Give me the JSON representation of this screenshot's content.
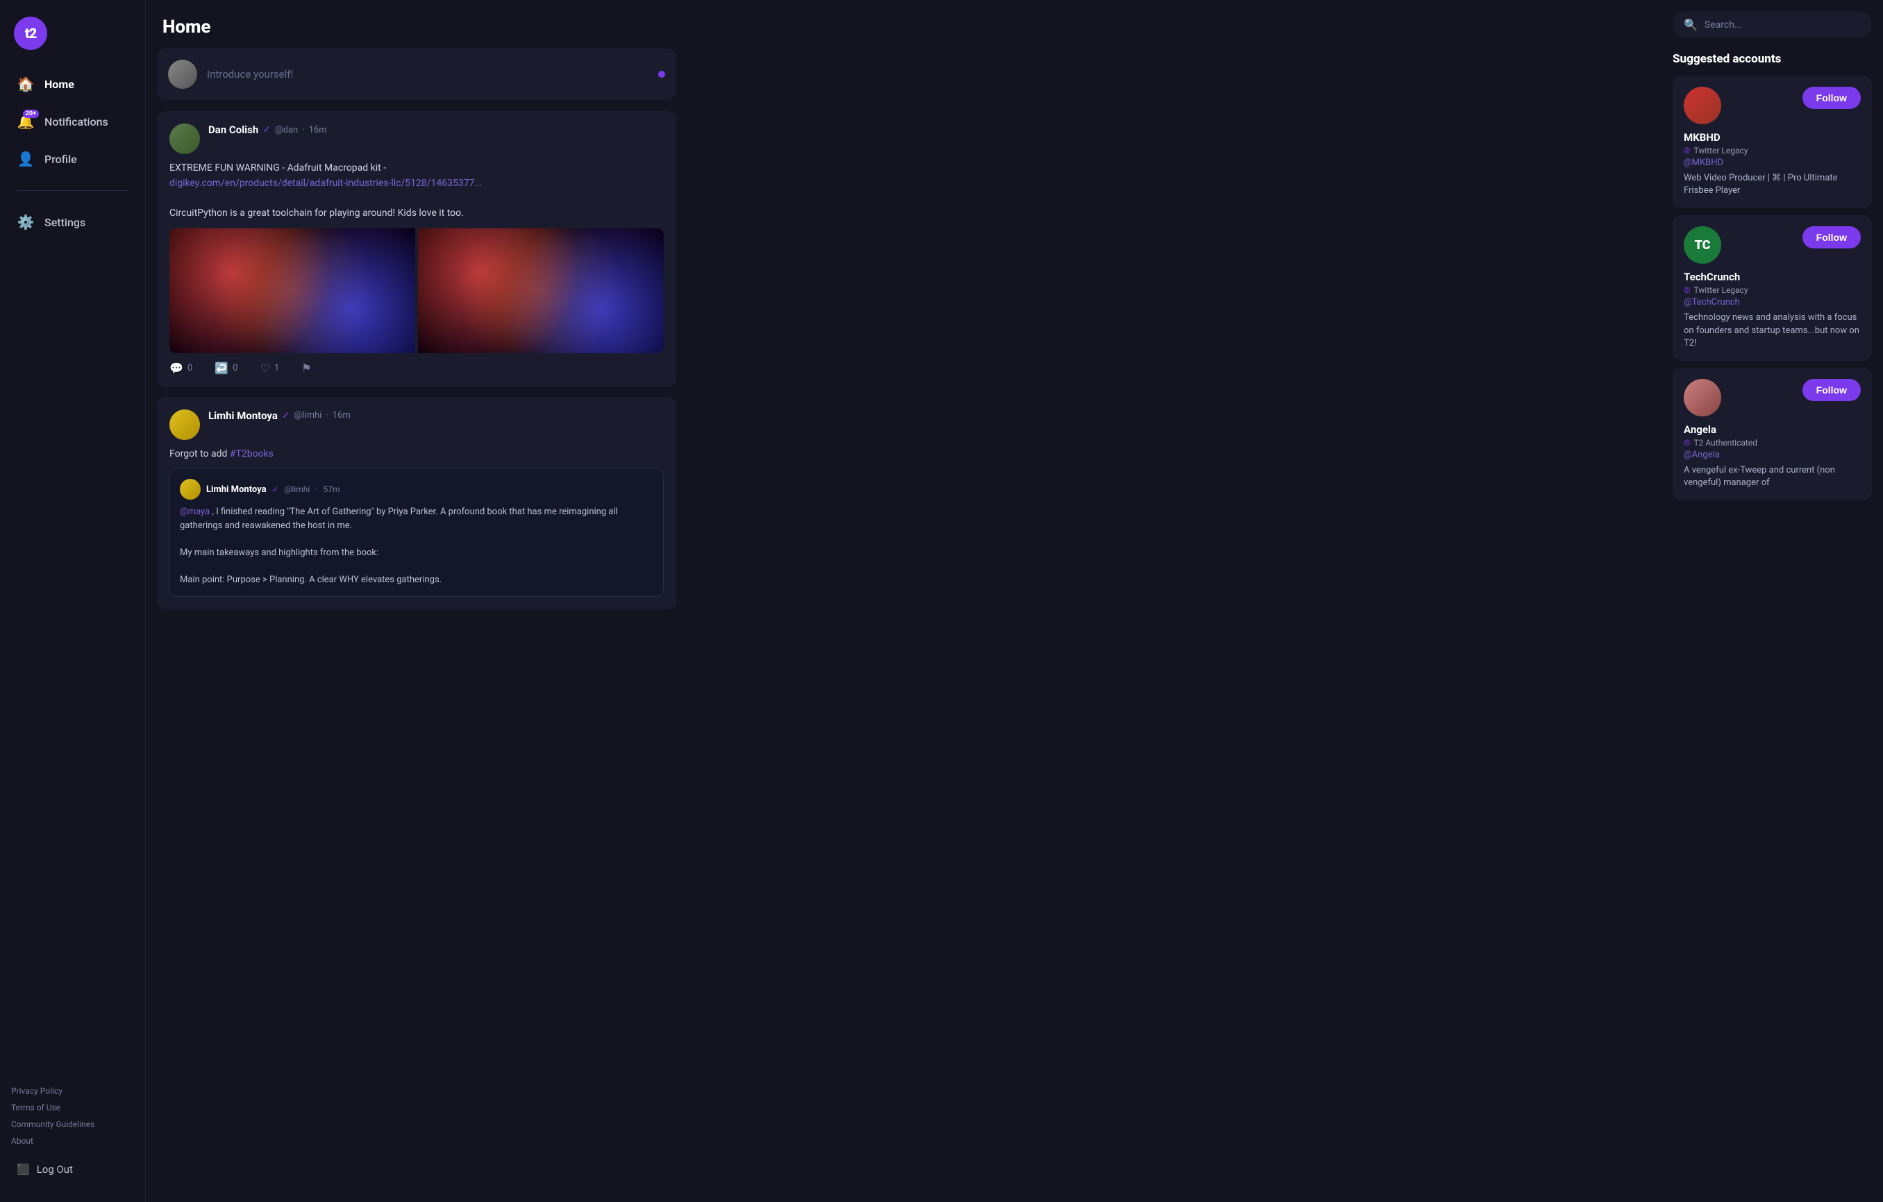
{
  "logo": {
    "text": "t2"
  },
  "nav": {
    "home": "Home",
    "notifications": "Notifications",
    "notif_badge": "20+",
    "profile": "Profile",
    "settings": "Settings"
  },
  "footer": {
    "privacy": "Privacy Policy",
    "terms": "Terms of Use",
    "guidelines": "Community Guidelines",
    "about": "About",
    "logout": "Log Out"
  },
  "page_title": "Home",
  "compose": {
    "placeholder": "Introduce yourself!"
  },
  "posts": [
    {
      "id": "post1",
      "author_name": "Dan Colish",
      "author_handle": "@dan",
      "time": "16m",
      "verified": true,
      "content_line1": "EXTREME FUN WARNING - Adafruit Macropad kit -",
      "link_text": "digikey.com/en/products/detail/adafruit-industries-llc/5128/14635377...",
      "content_line2": "CircuitPython is a great toolchain for playing around! Kids love it too.",
      "has_images": true,
      "actions": {
        "comments": "0",
        "reshares": "0",
        "likes": "1"
      }
    },
    {
      "id": "post2",
      "author_name": "Limhi Montoya",
      "author_handle": "@limhi",
      "time": "16m",
      "verified": true,
      "content": "Forgot to add #T2books",
      "nested": {
        "author_name": "Limhi Montoya",
        "author_handle": "@limhi",
        "time": "57m",
        "verified": true,
        "mention": "@maya",
        "content1": ", I finished reading \"The Art of Gathering\" by Priya Parker. A profound book that has me reimagining all gatherings and reawakened the host in me.",
        "content2": "My main takeaways and highlights from the book:",
        "content3": "Main point: Purpose > Planning. A clear WHY elevates gatherings."
      }
    }
  ],
  "search": {
    "placeholder": "Search..."
  },
  "suggested": {
    "title": "Suggested accounts",
    "accounts": [
      {
        "id": "mkbhd",
        "name": "MKBHD",
        "badge_type": "Twitter Legacy",
        "handle": "@MKBHD",
        "bio": "Web Video Producer | ⌘ | Pro Ultimate Frisbee Player",
        "avatar_initials": "",
        "avatar_type": "mkbhd",
        "follow_label": "Follow"
      },
      {
        "id": "techcrunch",
        "name": "TechCrunch",
        "badge_type": "Twitter Legacy",
        "handle": "@TechCrunch",
        "bio": "Technology news and analysis with a focus on founders and startup teams...but now on T2!",
        "avatar_initials": "TC",
        "avatar_type": "tc",
        "follow_label": "Follow"
      },
      {
        "id": "angela",
        "name": "Angela",
        "badge_type": "T2 Authenticated",
        "handle": "@Angela",
        "bio": "A vengeful ex-Tweep and current (non vengeful) manager of",
        "avatar_initials": "",
        "avatar_type": "angela",
        "follow_label": "Follow"
      }
    ]
  }
}
